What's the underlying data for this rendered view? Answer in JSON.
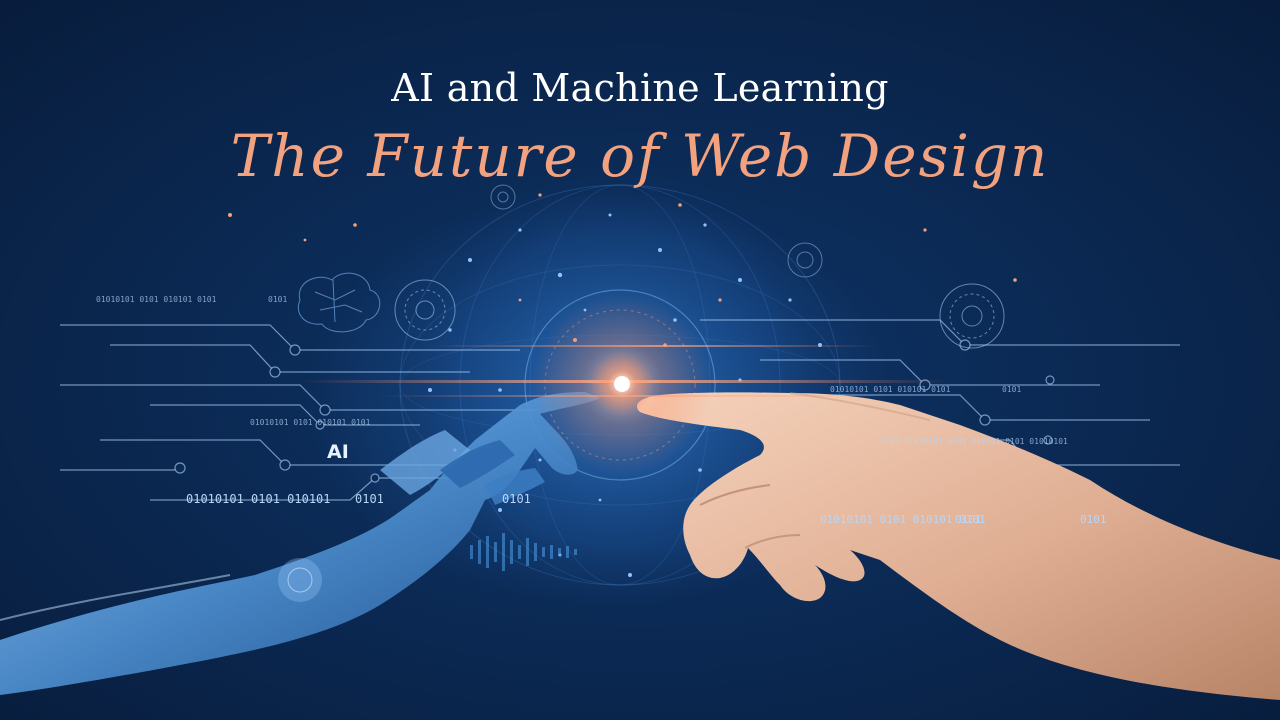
{
  "title": {
    "line1": "AI and Machine Learning",
    "line2": "The Future of Web Design"
  },
  "labels": {
    "ai": "AI",
    "binary_left_top": "01010101 0101 010101 0101",
    "binary_left_small": "0101",
    "binary_left_mid": "01010101 0101 010101 0101",
    "binary_left_bottom": "01010101 0101 010101",
    "binary_left_bottom_2": "0101",
    "binary_left_bottom_3": "0101",
    "binary_right_top": "01010101 0101 010101 0101",
    "binary_right_top_2": "0101",
    "binary_right_mid": "0101 01010101 0101 010101 0101 01010101",
    "binary_right_bottom": "01010101 0101 010101 0101",
    "binary_right_bottom_2": "0101",
    "binary_right_bottom_3": "0101"
  },
  "colors": {
    "background": "#0a2243",
    "title_white": "#ffffff",
    "title_accent": "#f2a27e",
    "glow": "#ff8a5c",
    "circuit": "#9cc4ee"
  }
}
